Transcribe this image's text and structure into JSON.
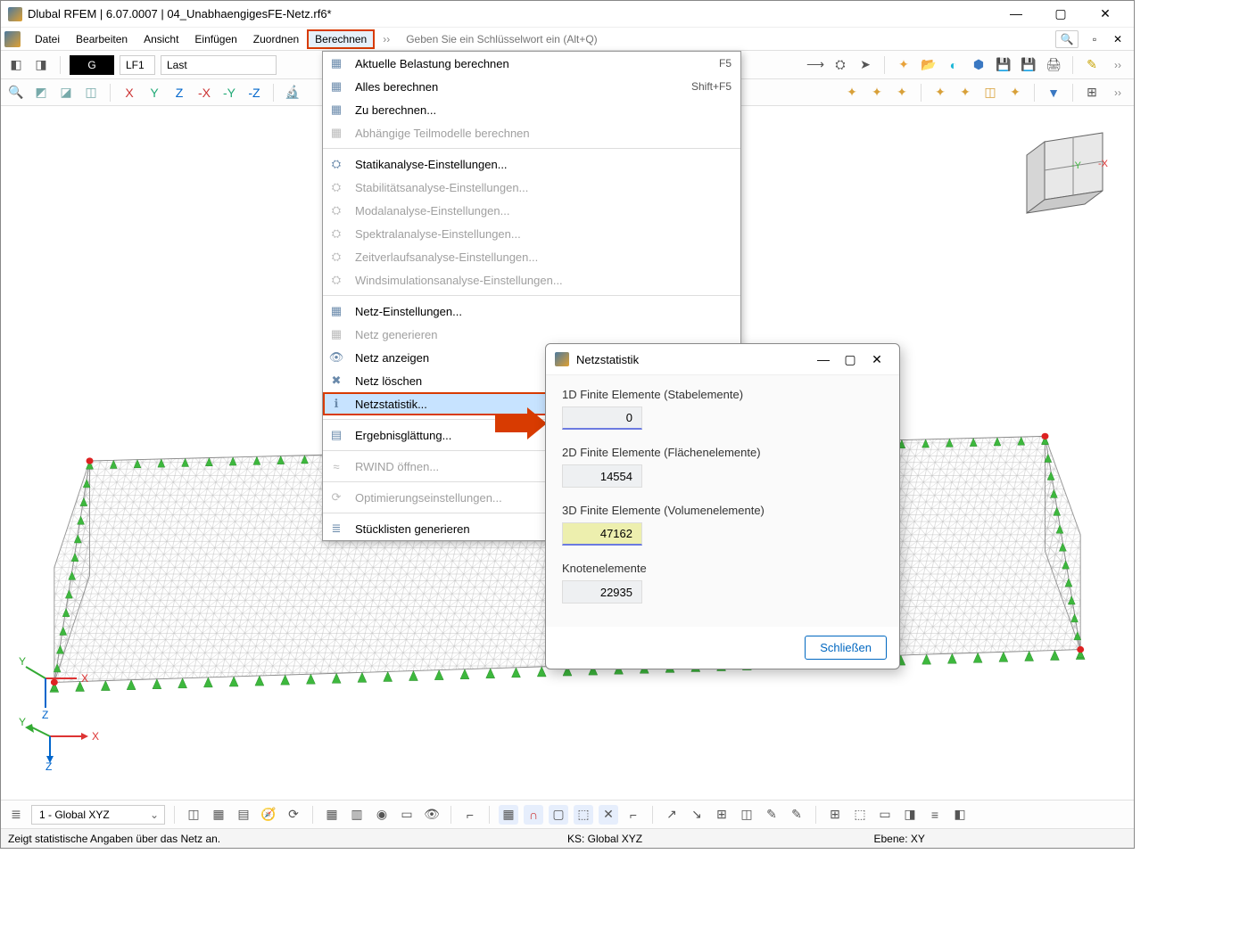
{
  "title": "Dlubal RFEM | 6.07.0007 | 04_UnabhaengigesFE-Netz.rf6*",
  "menu": {
    "items": [
      "Datei",
      "Bearbeiten",
      "Ansicht",
      "Einfügen",
      "Zuordnen",
      "Berechnen"
    ],
    "open_index": 5
  },
  "search_placeholder": "Geben Sie ein Schlüsselwort ein (Alt+Q)",
  "toolbar1": {
    "gbox": "G",
    "lf": "LF1",
    "last": "Last"
  },
  "dropdown": {
    "rows": [
      {
        "label": "Aktuelle Belastung berechnen",
        "shortcut": "F5",
        "enabled": true,
        "icon": "calc"
      },
      {
        "label": "Alles berechnen",
        "shortcut": "Shift+F5",
        "enabled": true,
        "icon": "calc"
      },
      {
        "label": "Zu berechnen...",
        "enabled": true,
        "icon": "calc"
      },
      {
        "label": "Abhängige Teilmodelle berechnen",
        "enabled": false,
        "icon": "calc2"
      },
      {
        "sep": true
      },
      {
        "label": "Statikanalyse-Einstellungen...",
        "enabled": true,
        "icon": "gear"
      },
      {
        "label": "Stabilitätsanalyse-Einstellungen...",
        "enabled": false,
        "icon": "gear"
      },
      {
        "label": "Modalanalyse-Einstellungen...",
        "enabled": false,
        "icon": "gear"
      },
      {
        "label": "Spektralanalyse-Einstellungen...",
        "enabled": false,
        "icon": "gear"
      },
      {
        "label": "Zeitverlaufsanalyse-Einstellungen...",
        "enabled": false,
        "icon": "gear"
      },
      {
        "label": "Windsimulationsanalyse-Einstellungen...",
        "enabled": false,
        "icon": "gear"
      },
      {
        "sep": true
      },
      {
        "label": "Netz-Einstellungen...",
        "enabled": true,
        "icon": "grid"
      },
      {
        "label": "Netz generieren",
        "enabled": false,
        "icon": "grid"
      },
      {
        "label": "Netz anzeigen",
        "enabled": true,
        "icon": "eye"
      },
      {
        "label": "Netz löschen",
        "enabled": true,
        "icon": "del"
      },
      {
        "label": "Netzstatistik...",
        "enabled": true,
        "icon": "info",
        "highlight": true
      },
      {
        "sep": true
      },
      {
        "label": "Ergebnisglättung...",
        "enabled": true,
        "icon": "smooth"
      },
      {
        "sep": true
      },
      {
        "label": "RWIND öffnen...",
        "enabled": false,
        "icon": "wind"
      },
      {
        "sep": true
      },
      {
        "label": "Optimierungseinstellungen...",
        "enabled": false,
        "icon": "opt"
      },
      {
        "sep": true
      },
      {
        "label": "Stücklisten generieren",
        "enabled": true,
        "icon": "list"
      }
    ]
  },
  "dialog": {
    "title": "Netzstatistik",
    "groups": [
      {
        "label": "1D Finite Elemente (Stabelemente)",
        "value": "0",
        "style": "first"
      },
      {
        "label": "2D Finite Elemente (Flächenelemente)",
        "value": "14554",
        "style": ""
      },
      {
        "label": "3D Finite Elemente (Volumenelemente)",
        "value": "47162",
        "style": "active"
      },
      {
        "label": "Knotenelemente",
        "value": "22935",
        "style": ""
      }
    ],
    "close": "Schließen"
  },
  "bottom_combo": "1 - Global XYZ",
  "status": {
    "s1": "Zeigt statistische Angaben über das Netz an.",
    "s2": "KS: Global XYZ",
    "s3": "Ebene: XY"
  }
}
